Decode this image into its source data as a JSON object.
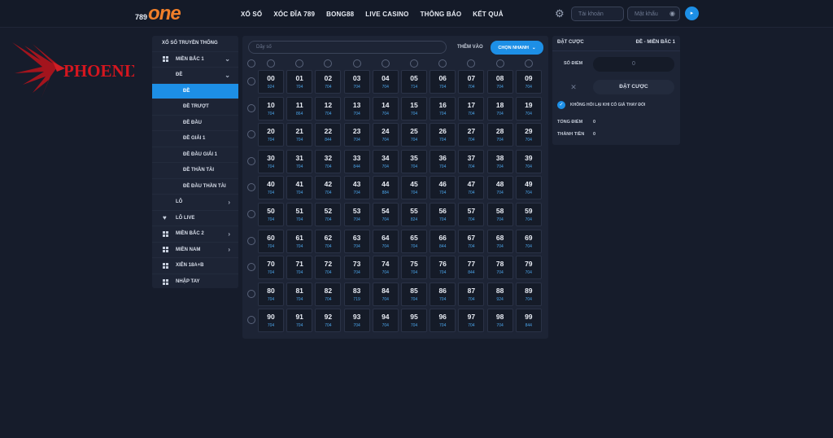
{
  "header": {
    "logo_num": "789",
    "logo_text": "one",
    "nav": [
      "XỔ SỐ",
      "XÓC ĐĨA 789",
      "BONG88",
      "LIVE CASINO",
      "THÔNG BÁO",
      "KẾT QUẢ"
    ],
    "username_placeholder": "Tài khoản",
    "password_placeholder": "Mật khẩu",
    "brand_color": "#f07f2a",
    "accent_color": "#1d8fe6"
  },
  "watermark": {
    "text": "PHOENIX"
  },
  "sidebar": {
    "title": "XỔ SỐ TRUYỀN THỐNG",
    "items": [
      {
        "label": "MIỀN BẮC 1",
        "icon": "grid-icon",
        "arrow": "⌄"
      },
      {
        "label": "ĐỀ",
        "arrow": "⌄"
      },
      {
        "label": "ĐỀ",
        "active": true
      },
      {
        "label": "ĐỀ TRƯỢT"
      },
      {
        "label": "ĐỀ ĐẦU"
      },
      {
        "label": "ĐỀ GIẢI 1"
      },
      {
        "label": "ĐỀ ĐẦU GIẢI 1"
      },
      {
        "label": "ĐỀ THẦN TÀI"
      },
      {
        "label": "ĐỀ ĐẦU THẦN TÀI"
      },
      {
        "label": "LÔ",
        "arrow": "›"
      },
      {
        "label": "LÔ LIVE",
        "icon": "heart-icon"
      },
      {
        "label": "MIỀN BẮC 2",
        "icon": "grid-icon",
        "arrow": "›"
      },
      {
        "label": "MIỀN NAM",
        "icon": "grid-icon",
        "arrow": "›"
      },
      {
        "label": "XIÊN 18A+B",
        "icon": "grid-icon"
      },
      {
        "label": "NHẬP TAY",
        "icon": "grid-icon"
      }
    ]
  },
  "board": {
    "search_placeholder": "Dãy số",
    "add_label": "THÊM VÀO",
    "quick_label": "CHỌN NHANH",
    "odds": [
      [
        "924",
        "704",
        "704",
        "704",
        "704",
        "714",
        "704",
        "704",
        "704",
        "704"
      ],
      [
        "704",
        "864",
        "704",
        "704",
        "704",
        "704",
        "704",
        "704",
        "704",
        "704"
      ],
      [
        "704",
        "704",
        "844",
        "704",
        "704",
        "704",
        "704",
        "704",
        "704",
        "704"
      ],
      [
        "704",
        "704",
        "704",
        "844",
        "704",
        "704",
        "704",
        "704",
        "704",
        "704"
      ],
      [
        "704",
        "704",
        "704",
        "704",
        "884",
        "704",
        "704",
        "704",
        "704",
        "704"
      ],
      [
        "704",
        "704",
        "704",
        "704",
        "704",
        "824",
        "704",
        "704",
        "704",
        "704"
      ],
      [
        "704",
        "704",
        "704",
        "704",
        "704",
        "704",
        "844",
        "704",
        "704",
        "704"
      ],
      [
        "704",
        "704",
        "704",
        "704",
        "704",
        "704",
        "704",
        "844",
        "704",
        "704"
      ],
      [
        "704",
        "704",
        "704",
        "719",
        "704",
        "704",
        "704",
        "704",
        "924",
        "704"
      ],
      [
        "704",
        "704",
        "704",
        "704",
        "704",
        "704",
        "704",
        "704",
        "704",
        "844"
      ]
    ]
  },
  "bet": {
    "title": "ĐẶT CƯỢC",
    "market": "ĐỀ - MIỀN BẮC 1",
    "points_label": "SỐ ĐIỂM",
    "points_value": "0",
    "clear_label": "✕",
    "submit_label": "ĐẶT CƯỢC",
    "no_ask_label": "KHÔNG HỎI LẠI KHI CÓ GIÁ THAY ĐỔI",
    "total_points_label": "TỔNG ĐIỂM",
    "total_points_value": "0",
    "total_money_label": "THÀNH TIỀN",
    "total_money_value": "0"
  }
}
